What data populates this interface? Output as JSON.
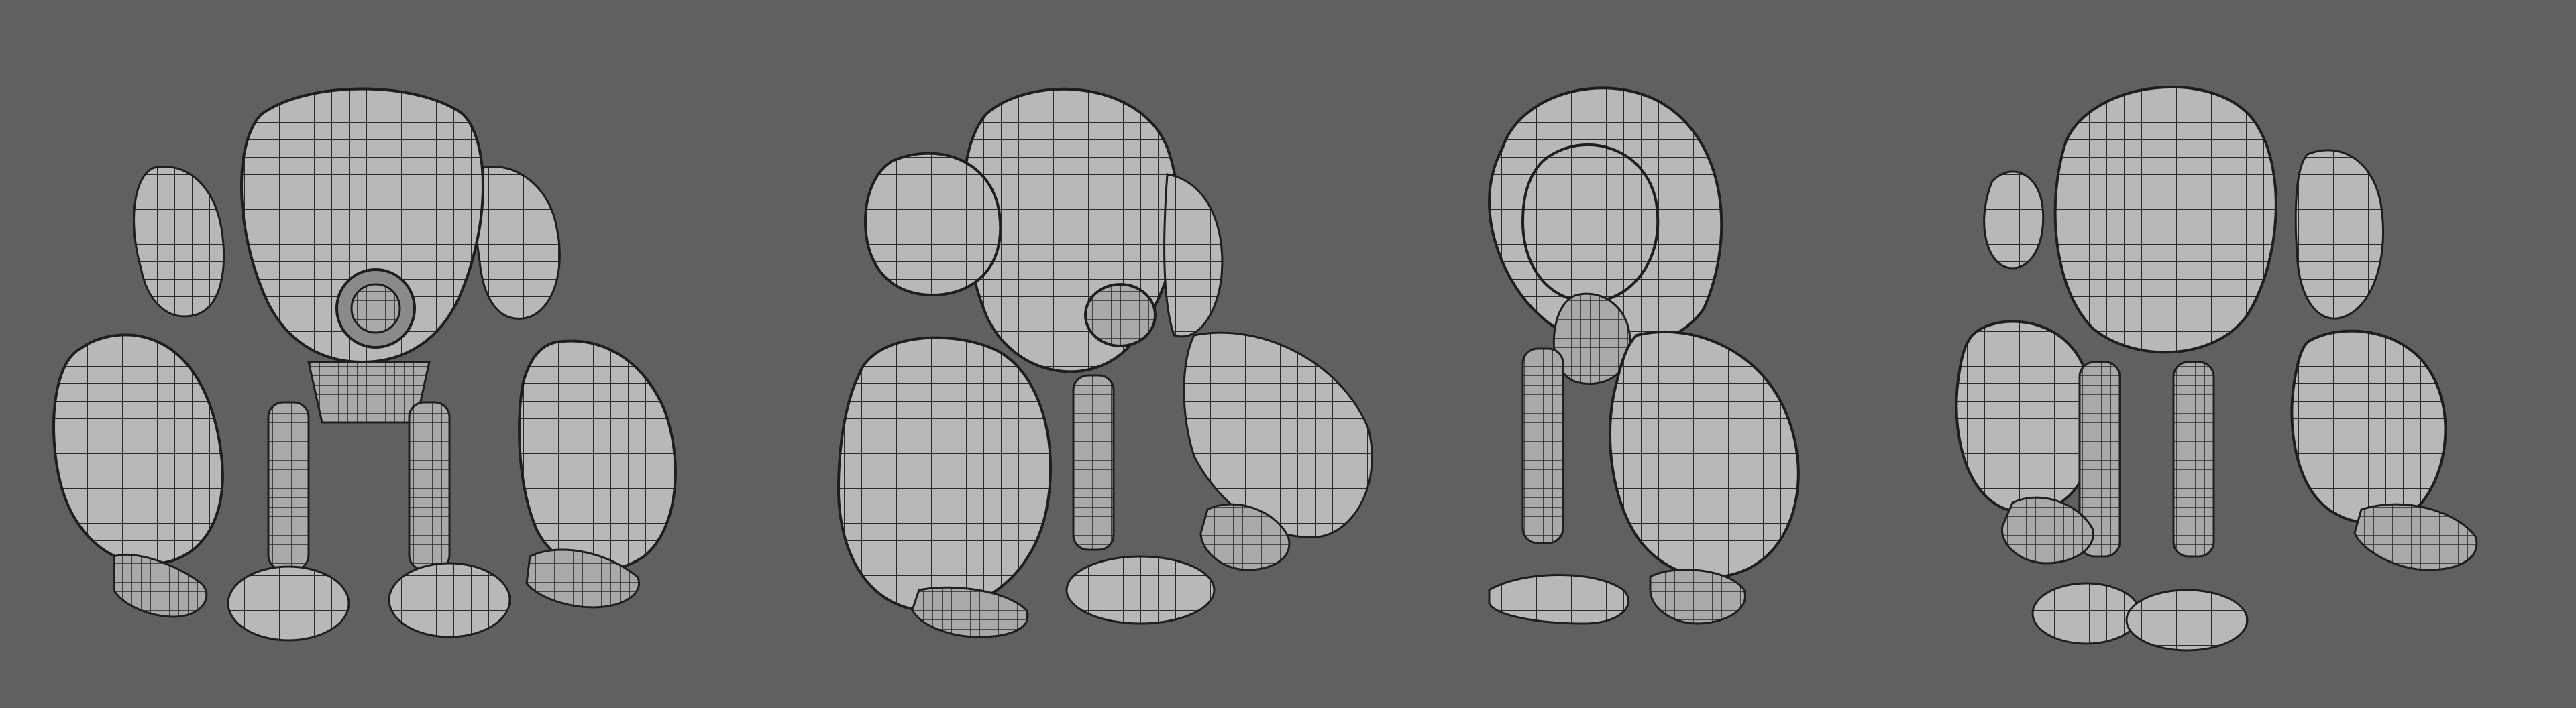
{
  "scene": {
    "background_color": "#606060",
    "mesh_color": "#b8b8b8",
    "wire_color": "#1e1e1e",
    "views": [
      {
        "id": "front"
      },
      {
        "id": "three-quarter"
      },
      {
        "id": "side"
      },
      {
        "id": "back"
      }
    ]
  }
}
